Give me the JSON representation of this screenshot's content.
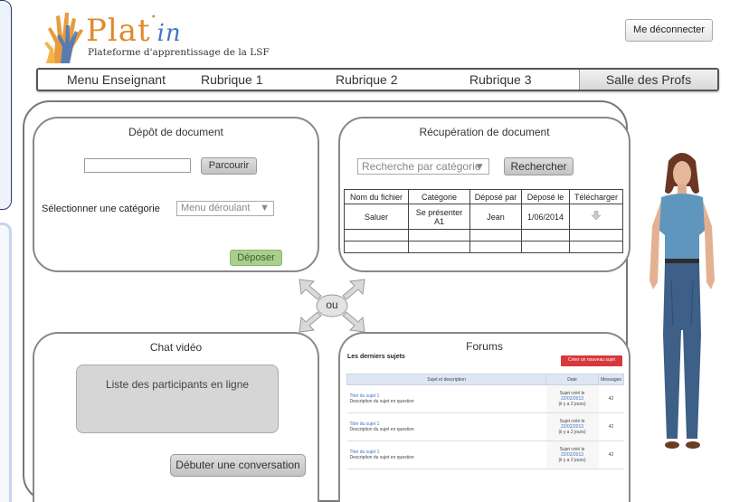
{
  "logo": {
    "title_main": "Plat",
    "title_suffix": "in",
    "subtitle": "Plateforme d'apprentissage de la LSF"
  },
  "header": {
    "logout_label": "Me déconnecter"
  },
  "nav": {
    "items": [
      "Menu Enseignant",
      "Rubrique 1",
      "Rubrique 2",
      "Rubrique 3",
      "Salle des Profs"
    ],
    "active": "Salle des Profs"
  },
  "upload": {
    "title": "Dépôt de document",
    "browse_label": "Parcourir",
    "category_label": "Sélectionner une catégorie",
    "category_select": "Menu déroulant",
    "submit_label": "Déposer"
  },
  "retrieve": {
    "title": "Récupération de document",
    "search_select": "Recherche par catégorie",
    "search_label": "Rechercher",
    "columns": [
      "Nom du fichier",
      "Catégorie",
      "Déposé par",
      "Déposé le",
      "Télécharger"
    ],
    "rows": [
      {
        "file": "Saluer",
        "category": "Se présenter A1",
        "by": "Jean",
        "date": "1/06/2014",
        "download_icon": "download-arrow-icon"
      }
    ]
  },
  "connector": {
    "label": "ou"
  },
  "chat": {
    "title": "Chat vidéo",
    "participants_label": "Liste des participants en ligne",
    "start_label": "Débuter une conversation"
  },
  "forums": {
    "title": "Forums",
    "latest_label": "Les derniers sujets",
    "new_topic_label": "Créer un nouveau sujet",
    "columns": [
      "Sujet et description",
      "Date",
      "Messages"
    ],
    "topics": [
      {
        "title": "Titre du sujet 1",
        "desc": "Description du sujet en question",
        "date1": "Sujet créé le",
        "date2": "22/02/2013",
        "date3": "(il y a 2 jours)",
        "messages": "42"
      },
      {
        "title": "Titre du sujet 1",
        "desc": "Description du sujet en question",
        "date1": "Sujet créé le",
        "date2": "22/02/2013",
        "date3": "(il y a 2 jours)",
        "messages": "42"
      },
      {
        "title": "Titre du sujet 1",
        "desc": "Description du sujet en question",
        "date1": "Sujet créé le",
        "date2": "22/02/2013",
        "date3": "(il y a 2 jours)",
        "messages": "42"
      }
    ]
  },
  "colors": {
    "green_button": "#a8d08c",
    "forum_red": "#d6383b",
    "link_blue": "#3f70c5",
    "logo_orange": "#e08a2c"
  }
}
